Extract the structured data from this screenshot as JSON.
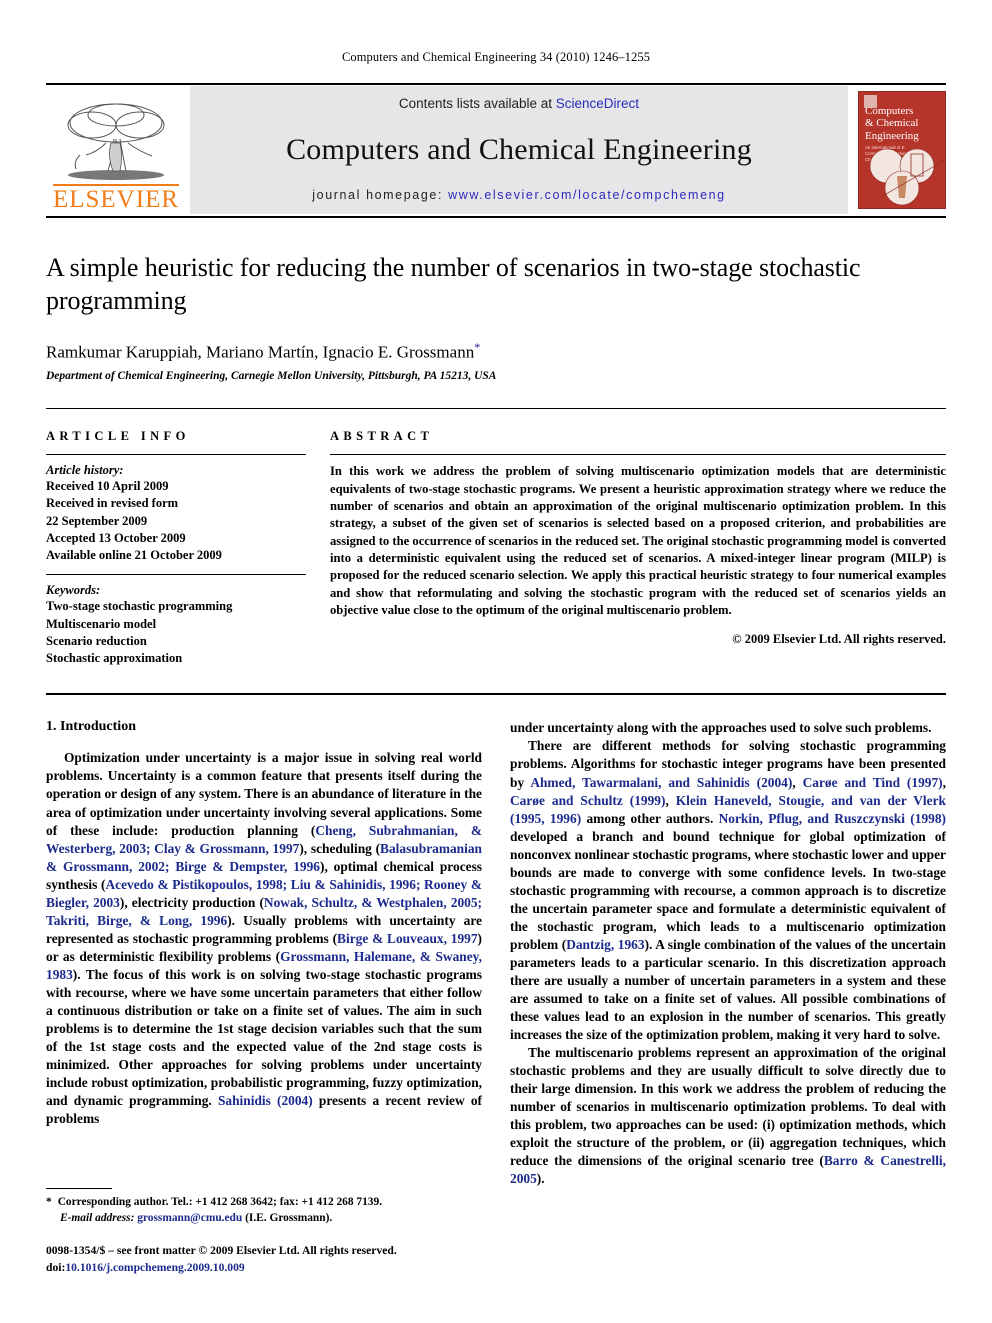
{
  "running_head": "Computers and Chemical Engineering 34 (2010) 1246–1255",
  "masthead": {
    "publisher_name": "ELSEVIER",
    "contents_prefix": "Contents lists available at",
    "sciencedirect": "ScienceDirect",
    "journal_title": "Computers and Chemical Engineering",
    "homepage_prefix": "journal homepage:",
    "homepage_url": "www.elsevier.com/locate/compchemeng",
    "cover": {
      "line1": "Computers",
      "line2": "& Chemical",
      "line3": "Engineering",
      "sub1": "An international of E",
      "sub2": "Computer Applications in",
      "sub3": "Chemical Engineering"
    }
  },
  "article": {
    "title": "A simple heuristic for reducing the number of scenarios in two-stage stochastic programming",
    "authors": "Ramkumar Karuppiah, Mariano Martín, Ignacio E. Grossmann",
    "corresponding_marker": "*",
    "affiliation": "Department of Chemical Engineering, Carnegie Mellon University, Pittsburgh, PA 15213, USA"
  },
  "article_info": {
    "heading": "ARTICLE INFO",
    "history_label": "Article history:",
    "history": [
      "Received 10 April 2009",
      "Received in revised form",
      "22 September 2009",
      "Accepted 13 October 2009",
      "Available online 21 October 2009"
    ],
    "keywords_label": "Keywords:",
    "keywords": [
      "Two-stage stochastic programming",
      "Multiscenario model",
      "Scenario reduction",
      "Stochastic approximation"
    ]
  },
  "abstract": {
    "heading": "ABSTRACT",
    "text": "In this work we address the problem of solving multiscenario optimization models that are deterministic equivalents of two-stage stochastic programs. We present a heuristic approximation strategy where we reduce the number of scenarios and obtain an approximation of the original multiscenario optimization problem. In this strategy, a subset of the given set of scenarios is selected based on a proposed criterion, and probabilities are assigned to the occurrence of scenarios in the reduced set. The original stochastic programming model is converted into a deterministic equivalent using the reduced set of scenarios. A mixed-integer linear program (MILP) is proposed for the reduced scenario selection. We apply this practical heuristic strategy to four numerical examples and show that reformulating and solving the stochastic program with the reduced set of scenarios yields an objective value close to the optimum of the original multiscenario problem.",
    "copyright": "© 2009 Elsevier Ltd. All rights reserved."
  },
  "body": {
    "section_heading": "1. Introduction",
    "left_paragraphs": [
      {
        "segments": [
          {
            "t": "Optimization under uncertainty is a major issue in solving real world problems. Uncertainty is a common feature that presents itself during the operation or design of any system. There is an abundance of literature in the area of optimization under uncertainty involving several applications. Some of these include: production planning ("
          },
          {
            "t": "Cheng, Subrahmanian, & Westerberg, 2003; Clay & Grossmann, 1997",
            "c": true
          },
          {
            "t": "), scheduling ("
          },
          {
            "t": "Balasubramanian & Grossmann, 2002; Birge & Dempster, 1996",
            "c": true
          },
          {
            "t": "), optimal chemical process synthesis ("
          },
          {
            "t": "Acevedo & Pistikopoulos, 1998; Liu & Sahinidis, 1996; Rooney & Biegler, 2003",
            "c": true
          },
          {
            "t": "), electricity production ("
          },
          {
            "t": "Nowak, Schultz, & Westphalen, 2005; Takriti, Birge, & Long, 1996",
            "c": true
          },
          {
            "t": "). Usually problems with uncertainty are represented as stochastic programming problems ("
          },
          {
            "t": "Birge & Louveaux, 1997",
            "c": true
          },
          {
            "t": ") or as deterministic flexibility problems ("
          },
          {
            "t": "Grossmann, Halemane, & Swaney, 1983",
            "c": true
          },
          {
            "t": "). The focus of this work is on solving two-stage stochastic programs with recourse, where we have some uncertain parameters that either follow a continuous distribution or take on a finite set of values. The aim in such problems is to determine the 1st stage decision variables such that the sum of the 1st stage costs and the expected value of the 2nd stage costs is minimized. Other approaches for solving problems under uncertainty include robust optimization, probabilistic programming, fuzzy optimization, and dynamic programming. "
          },
          {
            "t": "Sahinidis (2004)",
            "c": true
          },
          {
            "t": " presents a recent review of problems"
          }
        ]
      }
    ],
    "right_paragraphs": [
      {
        "noindent": true,
        "segments": [
          {
            "t": "under uncertainty along with the approaches used to solve such problems."
          }
        ]
      },
      {
        "segments": [
          {
            "t": "There are different methods for solving stochastic programming problems. Algorithms for stochastic integer programs have been presented by "
          },
          {
            "t": "Ahmed, Tawarmalani, and Sahinidis (2004)",
            "c": true
          },
          {
            "t": ", "
          },
          {
            "t": "Carøe and Tind (1997)",
            "c": true
          },
          {
            "t": ", "
          },
          {
            "t": "Carøe and Schultz (1999)",
            "c": true
          },
          {
            "t": ", "
          },
          {
            "t": "Klein Haneveld, Stougie, and van der Vlerk (1995, 1996)",
            "c": true
          },
          {
            "t": " among other authors. "
          },
          {
            "t": "Norkin, Pflug, and Ruszczynski (1998)",
            "c": true
          },
          {
            "t": " developed a branch and bound technique for global optimization of nonconvex nonlinear stochastic programs, where stochastic lower and upper bounds are made to converge with some confidence levels. In two-stage stochastic programming with recourse, a common approach is to discretize the uncertain parameter space and formulate a deterministic equivalent of the stochastic program, which leads to a multiscenario optimization problem ("
          },
          {
            "t": "Dantzig, 1963",
            "c": true
          },
          {
            "t": "). A single combination of the values of the uncertain parameters leads to a particular scenario. In this discretization approach there are usually a number of uncertain parameters in a system and these are assumed to take on a finite set of values. All possible combinations of these values lead to an explosion in the number of scenarios. This greatly increases the size of the optimization problem, making it very hard to solve."
          }
        ]
      },
      {
        "segments": [
          {
            "t": "The multiscenario problems represent an approximation of the original stochastic problems and they are usually difficult to solve directly due to their large dimension. In this work we address the problem of reducing the number of scenarios in multiscenario optimization problems. To deal with this problem, two approaches can be used: (i) optimization methods, which exploit the structure of the problem, or (ii) aggregation techniques, which reduce the dimensions of the original scenario tree ("
          },
          {
            "t": "Barro & Canestrelli, 2005",
            "c": true
          },
          {
            "t": ")."
          }
        ]
      }
    ]
  },
  "footnote": {
    "star": "*",
    "corresponding": "Corresponding author. Tel.: +1 412 268 3642; fax: +1 412 268 7139.",
    "email_label": "E-mail address:",
    "email": "grossmann@cmu.edu",
    "email_suffix": "(I.E. Grossmann)."
  },
  "footer": {
    "issn_line": "0098-1354/$ – see front matter © 2009 Elsevier Ltd. All rights reserved.",
    "doi_label": "doi:",
    "doi": "10.1016/j.compchemeng.2009.10.009"
  },
  "colors": {
    "link": "#1b2a8c",
    "elsevier_orange": "#f07d1a",
    "masthead_gray": "#e6e6e8",
    "cover_red": "#b5352a"
  }
}
